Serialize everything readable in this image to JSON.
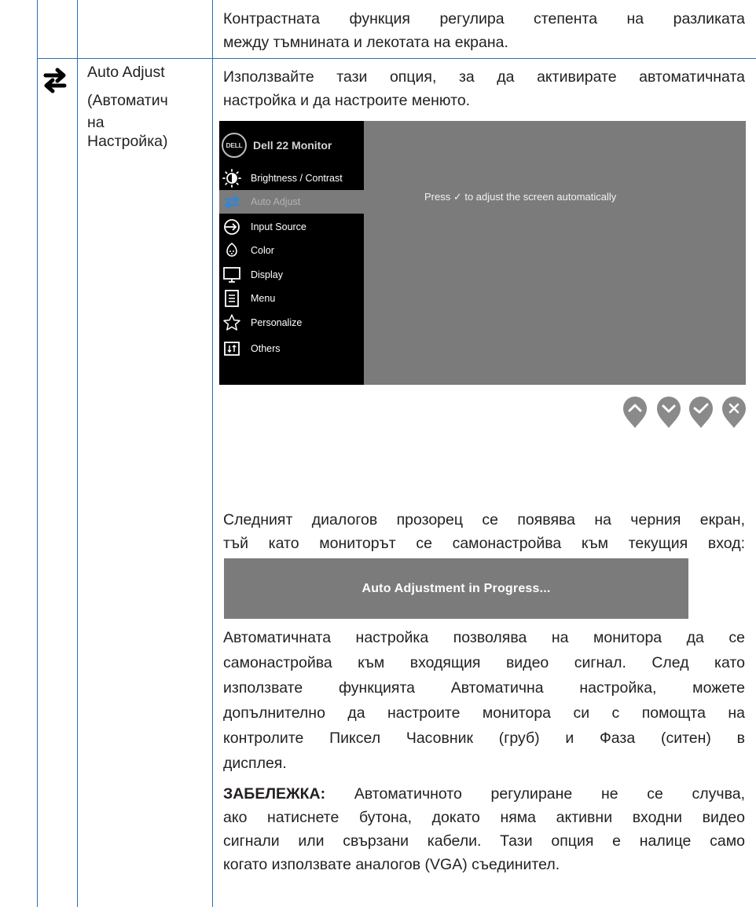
{
  "top_row": {
    "description": "Контрастната функция регулира степента на разликата между тъмнината и лекотата на екрана.",
    "line1": "Контрастната функция регулира степента на разликата",
    "line2": "между тъмнината и лекотата на екрана."
  },
  "auto_adjust_row": {
    "icon": "auto-adjust-arrows-icon",
    "name_lines": [
      "Auto Adjust",
      "(Автоматич",
      "на",
      "Настройка)"
    ],
    "intro_line1": "Използвайте тази опция, за да активирате автоматичната",
    "intro_line2": "настройка и да настроите менюто.",
    "osd": {
      "logo": "DELL",
      "title": "Dell 22 Monitor",
      "items": [
        {
          "label": "Brightness / Contrast",
          "icon": "brightness-icon"
        },
        {
          "label": "Auto Adjust",
          "icon": "auto-adjust-icon"
        },
        {
          "label": "Input Source",
          "icon": "input-source-icon"
        },
        {
          "label": "Color",
          "icon": "color-icon"
        },
        {
          "label": "Display",
          "icon": "display-icon"
        },
        {
          "label": "Menu",
          "icon": "menu-icon"
        },
        {
          "label": "Personalize",
          "icon": "star-icon"
        },
        {
          "label": "Others",
          "icon": "others-icon"
        }
      ],
      "selected": "Auto Adjust",
      "message": "Press ✓ to adjust the screen automatically"
    },
    "nav_buttons": [
      "up-icon",
      "down-icon",
      "check-icon",
      "close-icon"
    ],
    "dialog_intro_line1": "Следният диалогов прозорец се появява на черния екран,",
    "dialog_intro_line2": "тъй като мониторът се самонастройва към текущия вход:",
    "dialog_text": "Auto Adjustment in Progress...",
    "body_lines": [
      "Автоматичната настройка позволява на монитора да се",
      "самонастройва към входящия видео сигнал. След като",
      "използвате функцията Автоматична настройка, можете",
      "допълнително да настроите монитора си с помощта на",
      "контролите Пиксел Часовник (груб) и Фаза (ситен) в",
      "дисплея."
    ],
    "note_label": "ЗАБЕЛЕЖКА:",
    "note_lines": [
      " Автоматичното регулиране не се случва,",
      "ако натиснете бутона, докато няма активни входни видео",
      "сигнали или свързани кабели. Тази опция е налице само",
      "когато използвате аналогов (VGA) съединител."
    ]
  },
  "colors": {
    "grid_line": "#2a6fb0",
    "osd_background": "#7b7b7b",
    "osd_menu": "#000000",
    "nav_button": "#8a8a8a"
  }
}
